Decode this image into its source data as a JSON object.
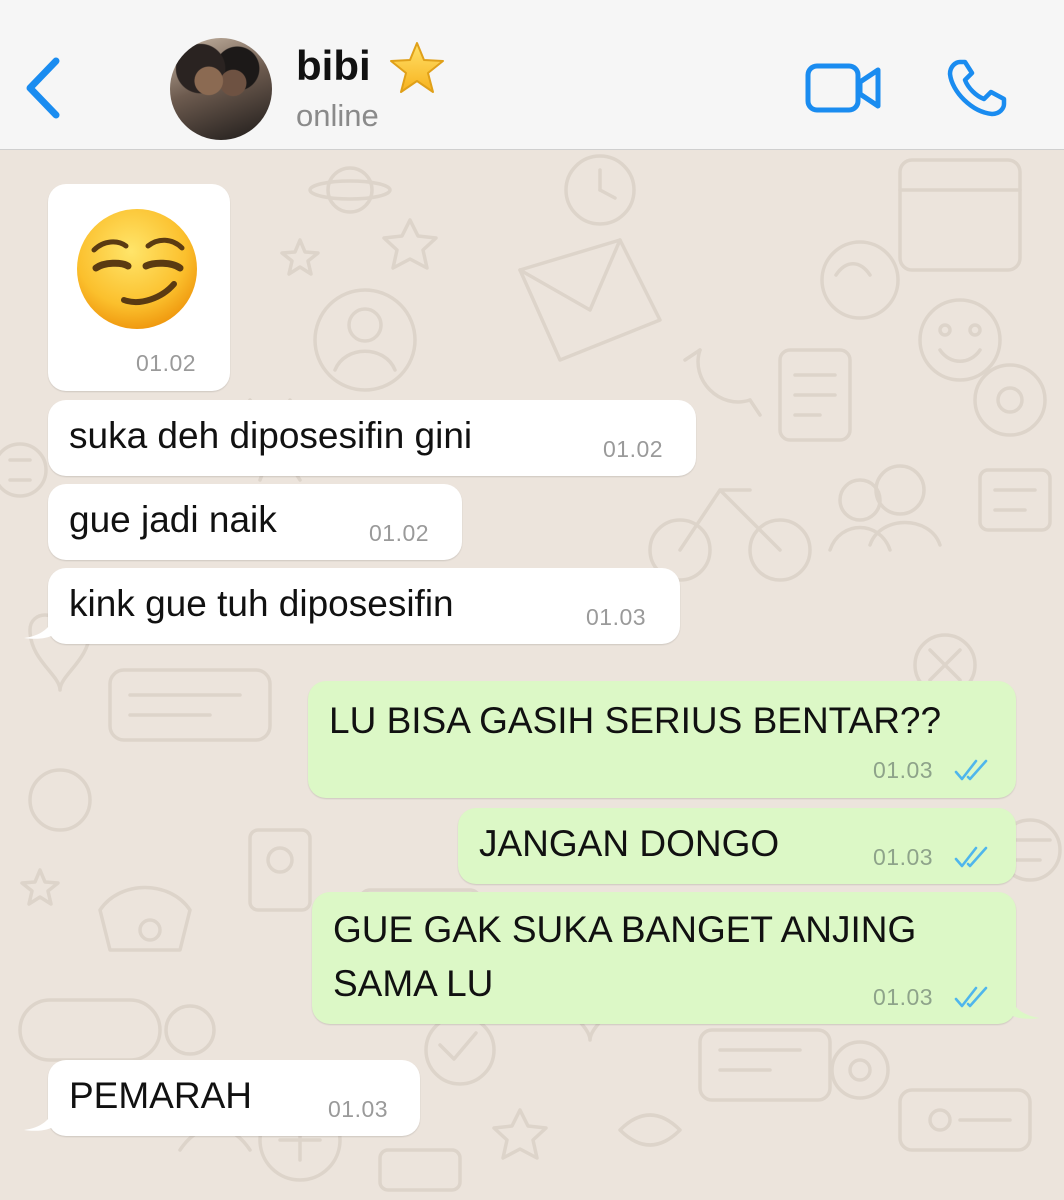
{
  "header": {
    "back_icon": "chevron-left-icon",
    "contact_name": "bibi",
    "contact_star_icon": "star-icon",
    "status": "online",
    "video_icon": "video-camera-icon",
    "call_icon": "phone-icon",
    "accent_color": "#1a8cf0"
  },
  "messages": [
    {
      "direction": "incoming",
      "type": "emoji",
      "emoji": "smirking-face",
      "time": "01.02"
    },
    {
      "direction": "incoming",
      "text": "suka deh diposesifin gini",
      "time": "01.02"
    },
    {
      "direction": "incoming",
      "text": "gue jadi naik",
      "time": "01.02"
    },
    {
      "direction": "incoming",
      "text": "kink gue tuh diposesifin",
      "time": "01.03"
    },
    {
      "direction": "outgoing",
      "text": "LU BISA GASIH SERIUS BENTAR??",
      "time": "01.03",
      "status": "read"
    },
    {
      "direction": "outgoing",
      "text": "JANGAN DONGO",
      "time": "01.03",
      "status": "read"
    },
    {
      "direction": "outgoing",
      "text_line1": "GUE GAK SUKA BANGET ANJING",
      "text_line2": "SAMA LU",
      "time": "01.03",
      "status": "read"
    },
    {
      "direction": "incoming",
      "text": "PEMARAH",
      "time": "01.03"
    }
  ],
  "colors": {
    "incoming_bubble": "#ffffff",
    "outgoing_bubble": "#dcf8c6",
    "read_ticks": "#4fb6ec",
    "chat_background": "#ece4dc"
  }
}
